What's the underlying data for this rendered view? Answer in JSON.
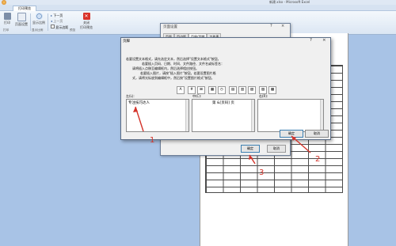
{
  "window": {
    "title": "新建.xlsx - Microsoft Excel"
  },
  "ribbon": {
    "tab": "打印预览",
    "buttons": [
      {
        "label": "打印",
        "icon": "print-icon"
      },
      {
        "label": "页面设置",
        "icon": "page-setup-icon"
      },
      {
        "label": "显示比例",
        "icon": "zoom-icon"
      },
      {
        "label": "下一页",
        "icon": "next-page-icon"
      },
      {
        "label": "上一页",
        "icon": "prev-page-icon"
      },
      {
        "label": "显示边距",
        "icon": "margins-checkbox"
      },
      {
        "label": "关闭\n打印预览",
        "icon": "close-preview-icon"
      }
    ],
    "groups": [
      "打印",
      "显示比例",
      "预览"
    ]
  },
  "page_setup": {
    "title": "页面设置",
    "tabs": [
      "页面",
      "页边距",
      "页眉/页脚",
      "工作表"
    ],
    "active_tab": "页眉/页脚",
    "ok": "确定",
    "cancel": "取消",
    "ctrl_help": "?",
    "ctrl_close": "×"
  },
  "header_dialog": {
    "title": "页脚",
    "ctrl_help": "?",
    "ctrl_close": "×",
    "instructions": [
      "若要设置文本格式，请先选定文本，然后选择\"设置文本格式\"按钮。",
      "若要插入页码、日期、时间、文件路径、文件名或标签名：",
      "请将插入点移至编辑框内，然后选择相应按钮。",
      "若要插入图片，请按\"插入图片\"按钮。若要设置图片格",
      "式，请将光标放到编辑框中，然后按\"设置图片格式\"按钮。"
    ],
    "toolbar_icons": [
      "format-text-icon",
      "page-number-icon",
      "page-count-icon",
      "date-icon",
      "time-icon",
      "file-path-icon",
      "file-name-icon",
      "sheet-name-icon",
      "insert-picture-icon",
      "format-picture-icon"
    ],
    "toolbar_glyphs": [
      "A",
      "#",
      "⊞",
      "▦",
      "◷",
      "▤",
      "▥",
      "▧",
      "▨",
      "▩"
    ],
    "left_label": "左(L):",
    "center_label": "中(C):",
    "right_label": "右(R):",
    "left_value": "专注技巧达人",
    "center_value": "第 &[页码] 页",
    "right_value": "",
    "ok": "确定",
    "cancel": "取消"
  },
  "annotations": [
    "1",
    "2",
    "3"
  ],
  "colors": {
    "annotation": "#d4332a"
  }
}
